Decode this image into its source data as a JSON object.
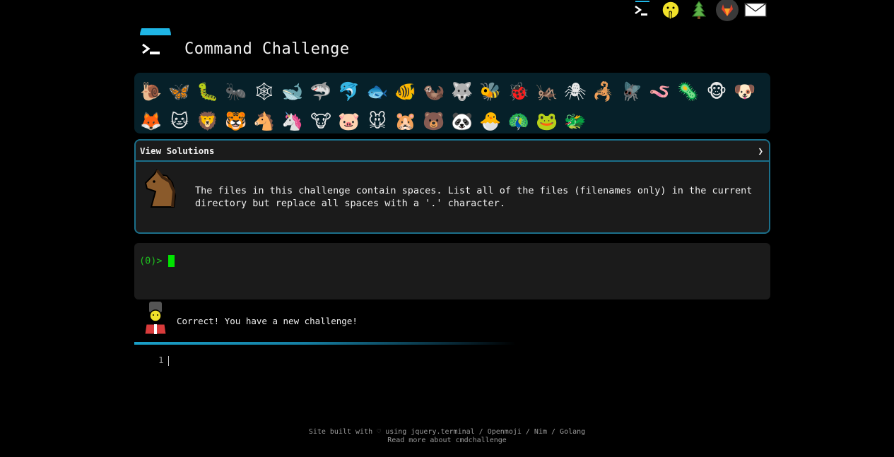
{
  "topbar": {
    "icons": [
      "terminal-icon",
      "shushing-face-icon",
      "tree-icon",
      "gitlab-icon",
      "email-icon"
    ]
  },
  "header": {
    "title": "Command Challenge"
  },
  "animals": [
    "🐌",
    "🦋",
    "🐛",
    "🐜",
    "🕸",
    "🐋",
    "🦈",
    "🐬",
    "🐟",
    "🐠",
    "🦦",
    "🐺",
    "🐝",
    "🐞",
    "🦗",
    "🕷",
    "🦂",
    "🪰",
    "🪱",
    "🦠",
    "🐵",
    "🐶",
    "🦊",
    "🐱",
    "🦁",
    "🐯",
    "🐴",
    "🦄",
    "🐮",
    "🐷",
    "🐭",
    "🐹",
    "🐻",
    "🐼",
    "🐣",
    "🦚",
    "🐸",
    "🐲"
  ],
  "card": {
    "header_label": "View Solutions",
    "toggle": "❯",
    "challenge_text": "The files in this challenge contain spaces. List all of the files (filenames only) in the current directory but replace all spaces with a '.' character."
  },
  "terminal": {
    "prompt": "(0)>"
  },
  "feedback": {
    "message": "Correct! You have a new challenge!"
  },
  "progress": {
    "fraction": 0.6
  },
  "editor": {
    "line_number": "1"
  },
  "footer": {
    "line1_prefix": "Site built with",
    "line1_heart": "♡",
    "line1_suffix": "using jquery.terminal / Openmoji / Nim / Golang",
    "line2": "Read more about cmdchallenge"
  }
}
